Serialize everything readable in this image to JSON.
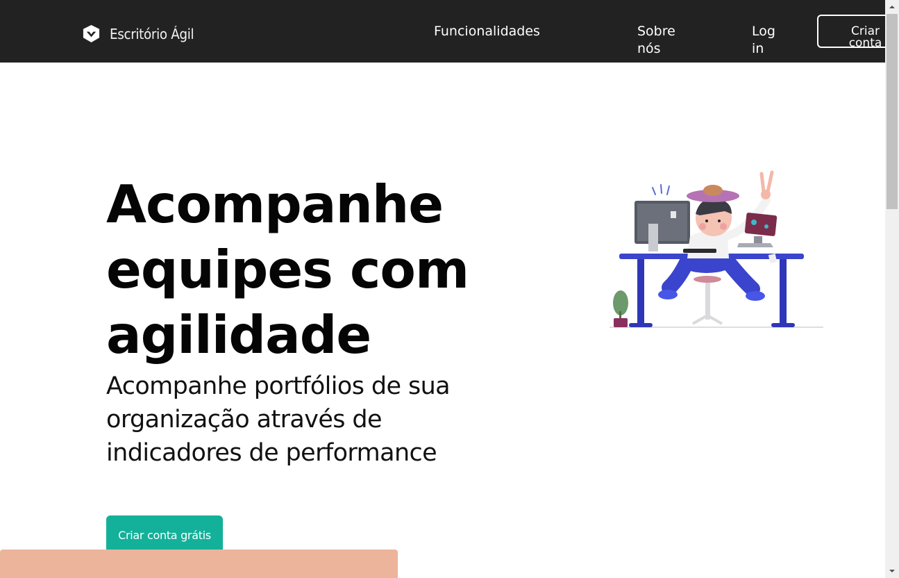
{
  "header": {
    "brand": {
      "name": "Escritório Ágil",
      "icon": "shield-check-logo"
    },
    "nav": {
      "funcionalidades": "Funcionalidades",
      "sobre": "Sobre nós",
      "login": "Log in",
      "cta": "Criar conta"
    },
    "background": "#222222"
  },
  "hero": {
    "title": "Acompanhe equipes com agilidade",
    "subtitle": "Acompanhe portfólios de sua organização através de indicadores de performance",
    "cta_label": "Criar conta grátis",
    "cta_color": "#13b09a",
    "illustration": "person-at-desk-illustration"
  },
  "banner": {
    "color": "#ecb49a"
  },
  "scrollbar": {
    "up_icon": "arrow-up-icon",
    "down_icon": "arrow-down-icon"
  }
}
